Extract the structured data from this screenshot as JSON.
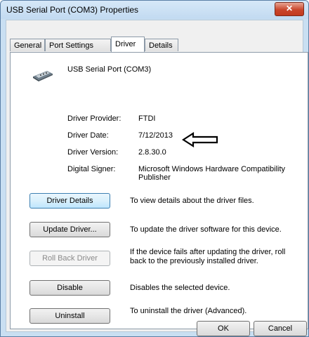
{
  "window": {
    "title": "USB Serial Port (COM3) Properties",
    "close_glyph": "✕"
  },
  "tabs": [
    {
      "label": "General"
    },
    {
      "label": "Port Settings"
    },
    {
      "label": "Driver",
      "active": true
    },
    {
      "label": "Details"
    }
  ],
  "device": {
    "name": "USB Serial Port (COM3)",
    "icon": "serial-port-connector-icon"
  },
  "info": [
    {
      "label": "Driver Provider:",
      "value": "FTDI"
    },
    {
      "label": "Driver Date:",
      "value": "7/12/2013"
    },
    {
      "label": "Driver Version:",
      "value": "2.8.30.0"
    },
    {
      "label": "Digital Signer:",
      "value": "Microsoft Windows Hardware Compatibility Publisher"
    }
  ],
  "annotation": {
    "icon": "left-arrow-icon"
  },
  "actions": [
    {
      "button": "Driver Details",
      "description": "To view details about the driver files.",
      "enabled": true,
      "focused": true
    },
    {
      "button": "Update Driver...",
      "description": "To update the driver software for this device.",
      "enabled": true
    },
    {
      "button": "Roll Back Driver",
      "description": "If the device fails after updating the driver, roll back to the previously installed driver.",
      "enabled": false
    },
    {
      "button": "Disable",
      "description": "Disables the selected device.",
      "enabled": true
    },
    {
      "button": "Uninstall",
      "description": "To uninstall the driver (Advanced).",
      "enabled": true
    }
  ],
  "footer": {
    "ok": "OK",
    "cancel": "Cancel"
  },
  "colors": {
    "titlebar": "#c9dff2",
    "close": "#c9462c",
    "focus_border": "#3c7fb1"
  }
}
